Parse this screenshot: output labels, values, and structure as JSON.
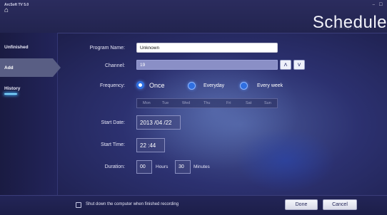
{
  "window": {
    "app_title": "ArcSoft TV 5.0",
    "heading": "Schedule",
    "controls": "– ☐"
  },
  "sidebar": {
    "items": [
      {
        "label": "Unfinished"
      },
      {
        "label": "Add"
      },
      {
        "label": "History"
      }
    ]
  },
  "form": {
    "program_name": {
      "label": "Program Name:",
      "value": "Unknown"
    },
    "channel": {
      "label": "Channel:",
      "value": "19"
    },
    "frequency": {
      "label": "Frequency:",
      "options": [
        "Once",
        "Everyday",
        "Every week"
      ],
      "selected": "Once",
      "days": [
        "Mon",
        "Tue",
        "Wed",
        "Thu",
        "Fri",
        "Sat",
        "Sun"
      ]
    },
    "start_date": {
      "label": "Start Date:",
      "value": "2013 /04 /22"
    },
    "start_time": {
      "label": "Start Time:",
      "value": "22 :44"
    },
    "duration": {
      "label": "Duration:",
      "hours": "00",
      "hours_unit": "Hours",
      "minutes": "30",
      "minutes_unit": "Minutes"
    }
  },
  "footer": {
    "shutdown_label": "Shut down the computer when finished recording",
    "done_label": "Done",
    "cancel_label": "Cancel"
  }
}
